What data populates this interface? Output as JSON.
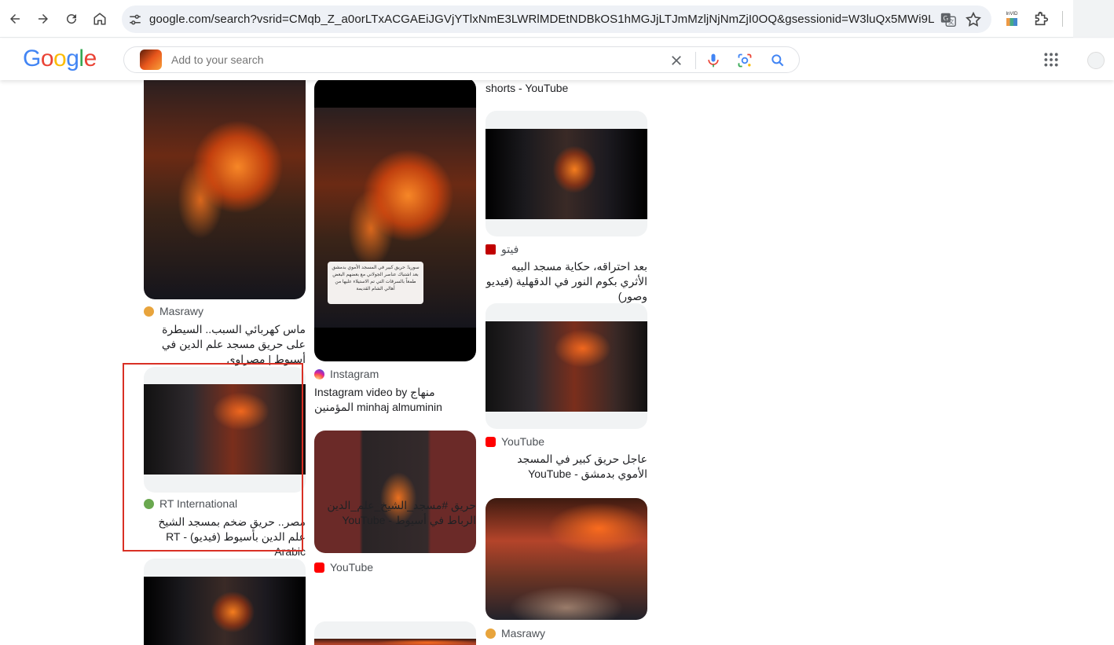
{
  "browser": {
    "url": "google.com/search?vsrid=CMqb_Z_a0orLTxACGAEiJGVjYTlxNmE3LWRlMDEtNDBkOS1hMGJjLTJmMzljNjNmZjI0OQ&gsessionid=W3luQx5MWi9Lrysd9QzKSezH7...",
    "extension_label": "InVID"
  },
  "google": {
    "logo": [
      "G",
      "o",
      "o",
      "g",
      "l",
      "e"
    ],
    "logo_colors": [
      "#4285F4",
      "#EA4335",
      "#FBBC05",
      "#4285F4",
      "#34A853",
      "#EA4335"
    ],
    "search_placeholder": "Add to your search"
  },
  "results": {
    "col1": [
      {
        "source": "Masrawy",
        "favicon_color": "#e8a43c",
        "title": "ماس كهربائي السبب.. السيطرة على حريق مسجد علم الدين في أسيوط | مصراوى"
      },
      {
        "source": "RT International",
        "favicon_color": "#6aa84f",
        "title": "مصر.. حريق ضخم بمسجد الشيخ علم الدين بأسيوط (فيديو) - RT Arabic"
      }
    ],
    "col2": [
      {
        "source": "Instagram",
        "favicon_color": "#e1306c",
        "title": "Instagram video by منهاج المؤمنين minhaj almuminin",
        "overlay": "سوريا: حريق كبير في المسجد الأموي بدمشق بعد اشتباك عناصر الجولاني مع بعضهم البعض طمعاً بالسرقات التي تم الاستيلاء عليها من أهالي الشام القديمة"
      },
      {
        "source": "YouTube",
        "favicon_color": "#ff0000",
        "title": "حريق #مسجد_الشيخ_علم_الدين الرباط في أسيوط - YouTube"
      }
    ],
    "col3": [
      {
        "title": "shorts - YouTube"
      },
      {
        "source": "فيتو",
        "favicon_color": "#c00000",
        "title": "بعد احتراقه، حكاية مسجد البيه الأثري بكوم النور في الدقهلية (فيديو وصور)"
      },
      {
        "source": "YouTube",
        "favicon_color": "#ff0000",
        "title": "عاجل حريق كبير في المسجد الأموي بدمشق - YouTube"
      },
      {
        "source": "Masrawy",
        "favicon_color": "#e8a43c"
      }
    ]
  }
}
